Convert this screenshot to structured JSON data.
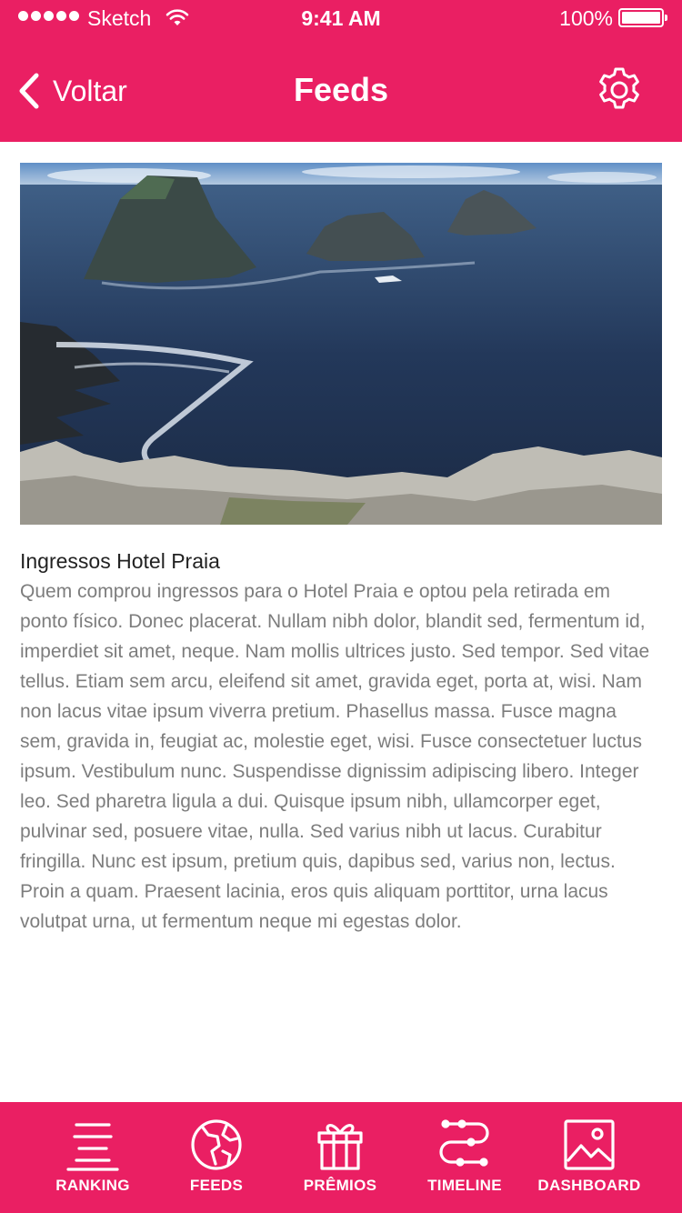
{
  "status_bar": {
    "carrier": "Sketch",
    "time": "9:41 AM",
    "battery": "100%"
  },
  "nav": {
    "back_label": "Voltar",
    "title": "Feeds"
  },
  "post": {
    "title": "Ingressos Hotel Praia",
    "body": "Quem comprou ingressos para o Hotel Praia e optou pela retirada em ponto físico. Donec placerat. Nullam nibh dolor, blandit sed, fermentum id, imperdiet sit amet, neque. Nam mollis ultrices justo. Sed tempor. Sed vitae tellus. Etiam sem arcu, eleifend sit amet, gravida eget, porta at, wisi. Nam non lacus vitae ipsum viverra pretium. Phasellus massa. Fusce magna sem, gravida in, feugiat ac, molestie eget, wisi. Fusce consectetuer luctus ipsum. Vestibulum nunc. Suspendisse dignissim adipiscing libero. Integer leo. Sed pharetra ligula a dui. Quisque ipsum nibh, ullamcorper eget, pulvinar sed, posuere vitae, nulla. Sed varius nibh ut lacus. Curabitur fringilla. Nunc est ipsum, pretium quis, dapibus sed, varius non, lectus. Proin a quam. Praesent lacinia, eros quis aliquam porttitor, urna lacus volutpat urna, ut fermentum neque mi egestas dolor."
  },
  "tabs": [
    {
      "label": "RANKING",
      "icon": "ranking-icon"
    },
    {
      "label": "FEEDS",
      "icon": "globe-icon"
    },
    {
      "label": "PRÊMIOS",
      "icon": "gift-icon"
    },
    {
      "label": "TIMELINE",
      "icon": "timeline-icon"
    },
    {
      "label": "DASHBOARD",
      "icon": "image-icon"
    }
  ],
  "colors": {
    "brand": "#ea1f63",
    "body_text": "#7d7d7d",
    "title_text": "#222222"
  }
}
